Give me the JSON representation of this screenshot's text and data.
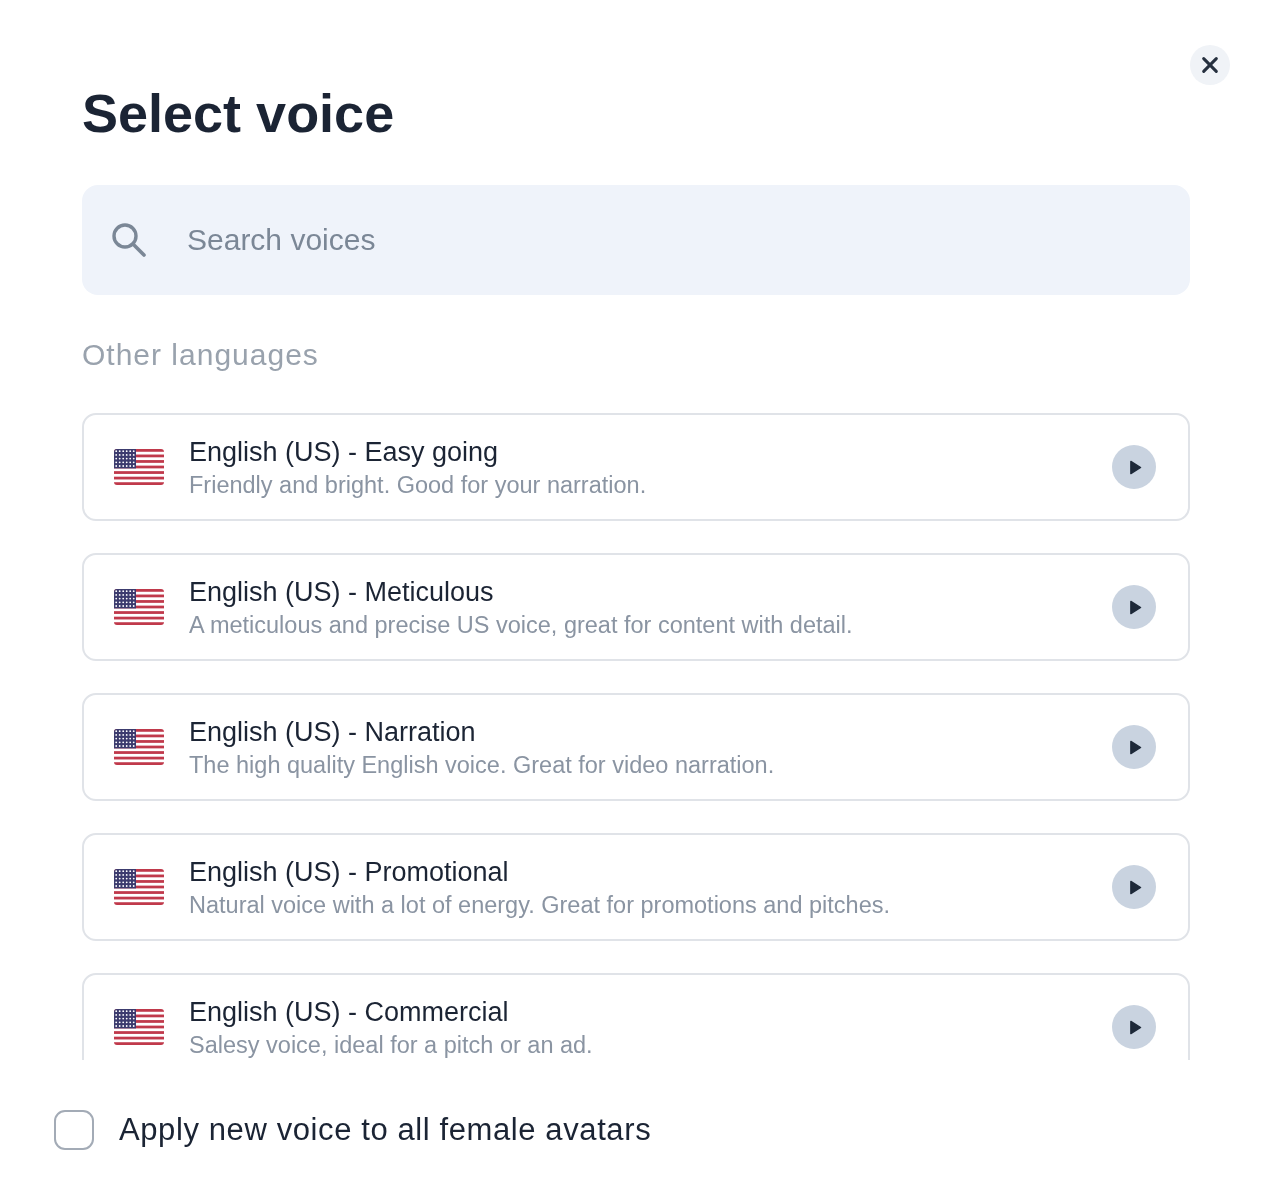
{
  "dialog": {
    "title": "Select voice"
  },
  "search": {
    "placeholder": "Search voices"
  },
  "section_label": "Other languages",
  "voices": [
    {
      "name": "English (US) - Easy going",
      "description": "Friendly and bright. Good for your narration."
    },
    {
      "name": "English (US) - Meticulous",
      "description": "A meticulous and precise US voice, great for content with detail."
    },
    {
      "name": "English (US) - Narration",
      "description": "The high quality English voice. Great for video narration."
    },
    {
      "name": "English (US) - Promotional",
      "description": "Natural voice with a lot of energy. Great for promotions and pitches."
    },
    {
      "name": "English (US) - Commercial",
      "description": "Salesy voice, ideal for a pitch or an ad."
    }
  ],
  "apply_all": {
    "label": "Apply new voice to all female avatars",
    "checked": false
  }
}
